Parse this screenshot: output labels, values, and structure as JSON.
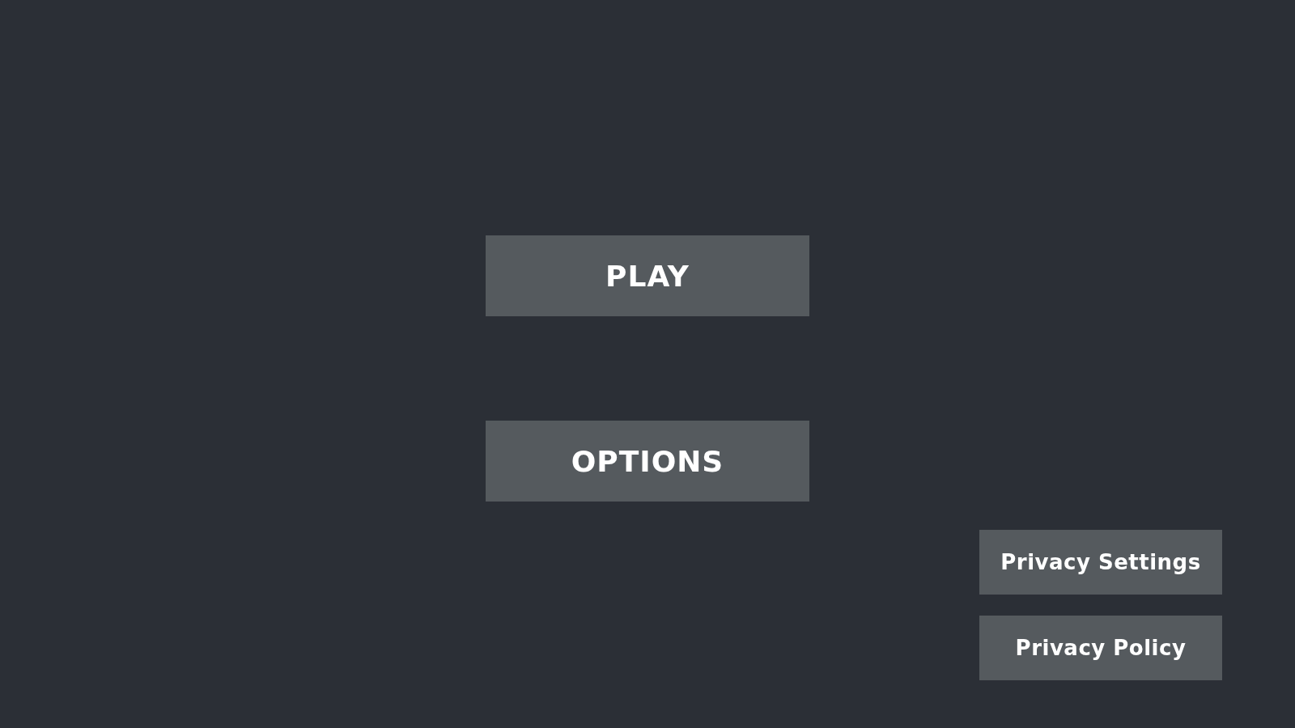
{
  "menu": {
    "buttons": [
      {
        "label": "PLAY"
      },
      {
        "label": "OPTIONS"
      }
    ]
  },
  "privacy": {
    "buttons": [
      {
        "label": "Privacy Settings"
      },
      {
        "label": "Privacy Policy"
      }
    ]
  }
}
